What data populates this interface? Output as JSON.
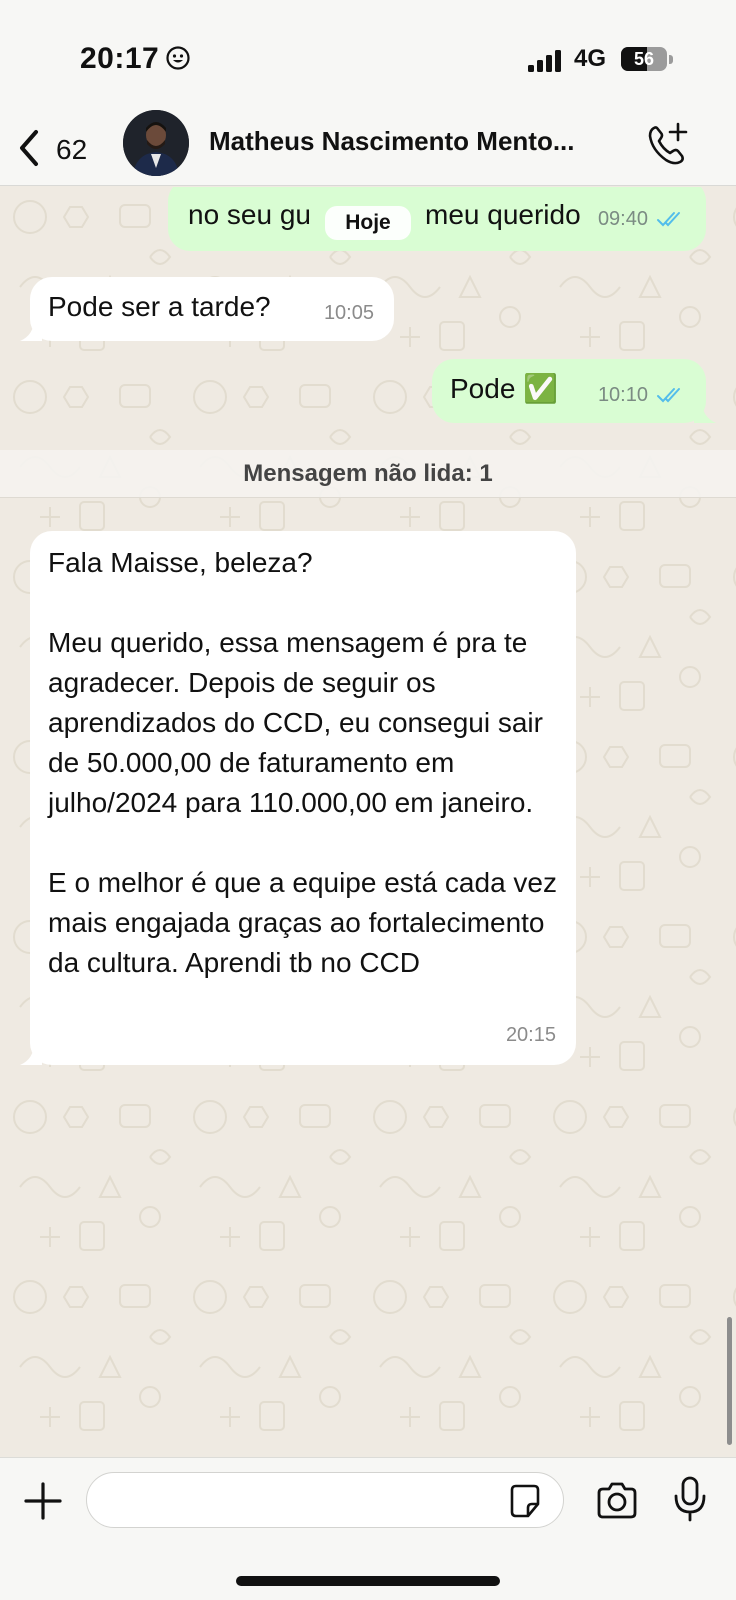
{
  "status_bar": {
    "time": "20:17",
    "network": "4G",
    "battery": "56",
    "battery_level": 0.56
  },
  "header": {
    "back_count": "62",
    "contact_name": "Matheus Nascimento Mento..."
  },
  "chat": {
    "date_chip": "Hoje",
    "unread_label": "Mensagem não lida: 1",
    "messages": [
      {
        "direction": "out",
        "text": "no seu gu…meu querido",
        "visible_text_left": "no seu gu",
        "visible_text_right": "meu querido",
        "time": "09:40",
        "read": true
      },
      {
        "direction": "in",
        "text": "Pode ser a tarde?",
        "time": "10:05"
      },
      {
        "direction": "out",
        "text": "Pode ✅",
        "time": "10:10",
        "read": true
      },
      {
        "direction": "in",
        "text": "Fala Maisse, beleza?\n\nMeu querido, essa mensagem é pra te agradecer. Depois de seguir os aprendizados do CCD, eu consegui sair de 50.000,00 de faturamento em julho/2024 para 110.000,00 em janeiro.\n\nE o melhor é que a equipe está cada vez mais engajada graças ao fortalecimento da cultura. Aprendi tb no CCD",
        "time": "20:15"
      }
    ]
  },
  "composer": {
    "input_value": "",
    "input_placeholder": ""
  },
  "colors": {
    "outgoing_bubble": "#d9fdd3",
    "incoming_bubble": "#ffffff",
    "read_ticks": "#53bdeb",
    "chat_background": "#efeae2"
  }
}
